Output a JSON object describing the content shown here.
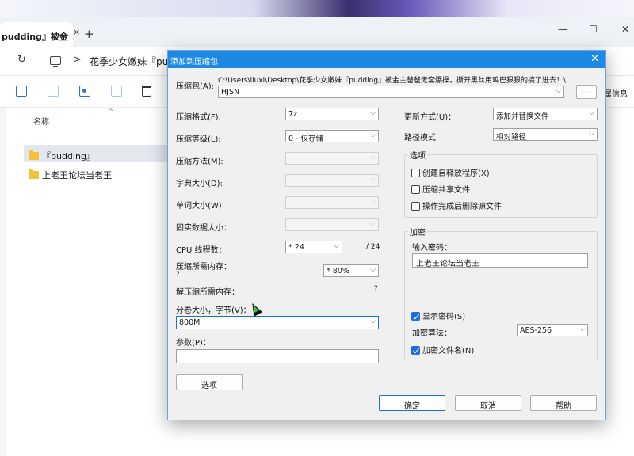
{
  "explorer": {
    "tab_label": "pudding』被金",
    "tab_close": "×",
    "tab_new": "+",
    "win_min": "—",
    "win_max": "☐",
    "win_close": "✕",
    "refresh": "↻",
    "crumb_sep": ">",
    "breadcrumb": "花季少女嫩妹『pud",
    "properties_fragment": "属信息",
    "column_name": "名称",
    "sort_caret": "^",
    "files": [
      {
        "name": "『pudding』"
      },
      {
        "name": "上老王论坛当老王"
      }
    ]
  },
  "dialog": {
    "title": "添加到压缩包",
    "close": "✕",
    "archive_label": "压缩包(A):",
    "archive_path": "C:\\Users\\liuxi\\Desktop\\花季少女嫩妹『pudding』被金主爸爸无套爆操，撕开黑丝用鸡巴狠狠的搞了进去！\\",
    "archive_name": "HJSN",
    "browse": "...",
    "format_label": "压缩格式(F):",
    "format_value": "7z",
    "level_label": "压缩等级(L):",
    "level_value": "0 - 仅存储",
    "method_label": "压缩方法(M):",
    "dict_label": "字典大小(D):",
    "word_label": "单词大小(W):",
    "solid_label": "固实数据大小：",
    "cpu_label": "CPU 线程数：",
    "cpu_value": "* 24",
    "cpu_total": "/ 24",
    "mem_label": "压缩所需内存：",
    "mem_value": "?",
    "mem_percent": "* 80%",
    "decomp_label": "解压缩所需内存：",
    "decomp_value": "?",
    "split_label": "分卷大小，字节(V)：",
    "split_value": "800M",
    "params_label": "参数(P)：",
    "options_button": "选项",
    "update_label": "更新方式(U)：",
    "update_value": "添加并替换文件",
    "path_label": "路径模式",
    "path_value": "相对路径",
    "options_group": "选项",
    "opt_sfx": "创建自释放程序(X)",
    "opt_shared": "压缩共享文件",
    "opt_delete": "操作完成后删除源文件",
    "encrypt_group": "加密",
    "password_label": "输入密码：",
    "password_value": "上老王论坛当老王",
    "show_password": "显示密码(S)",
    "algo_label": "加密算法：",
    "algo_value": "AES-256",
    "encrypt_names": "加密文件名(N)",
    "ok": "确定",
    "cancel": "取消",
    "help": "帮助",
    "arrow": "⌵"
  }
}
